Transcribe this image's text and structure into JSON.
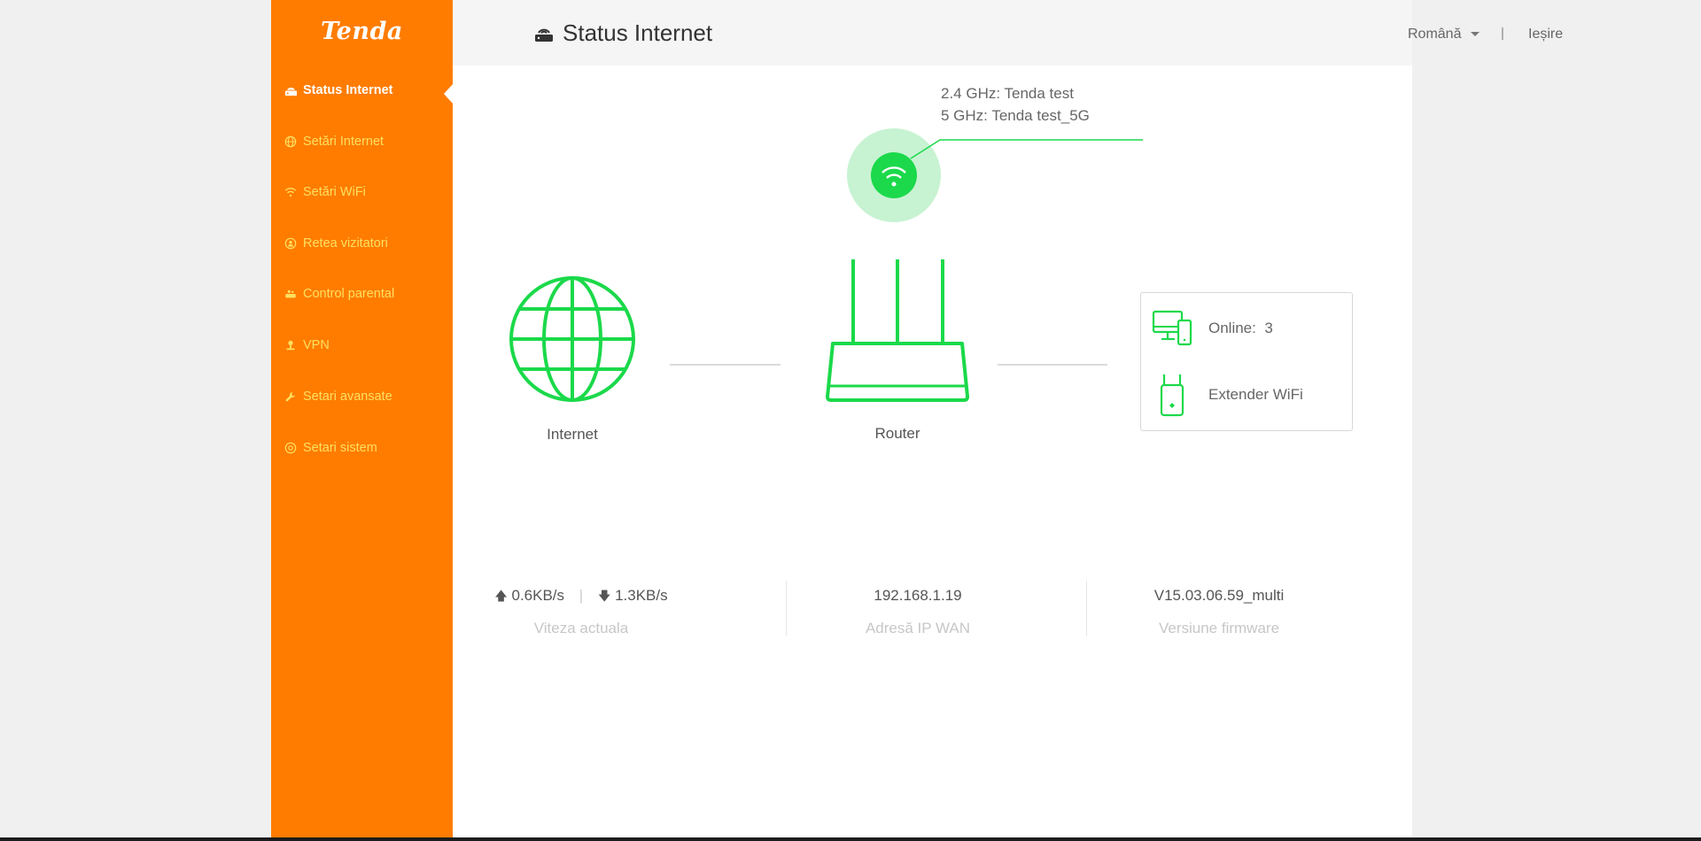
{
  "brand": {
    "logo": "Tenda"
  },
  "sidebar": {
    "items": [
      {
        "label": "Status Internet",
        "icon": "router-status-icon",
        "active": true
      },
      {
        "label": "Setări Internet",
        "icon": "globe-icon"
      },
      {
        "label": "Setări WiFi",
        "icon": "wifi-icon"
      },
      {
        "label": "Retea vizitatori",
        "icon": "guest-network-icon"
      },
      {
        "label": "Control parental",
        "icon": "parental-control-icon"
      },
      {
        "label": "VPN",
        "icon": "vpn-icon"
      },
      {
        "label": "Setari avansate",
        "icon": "wrench-icon"
      },
      {
        "label": "Setari sistem",
        "icon": "gear-icon"
      }
    ]
  },
  "header": {
    "title": "Status Internet",
    "language": "Română",
    "separator": "|",
    "logout": "Ieșire"
  },
  "topology": {
    "wifi": {
      "band_24": "2.4 GHz: Tenda test",
      "band_5": "5 GHz: Tenda test_5G"
    },
    "internet_label": "Internet",
    "router_label": "Router",
    "devices": {
      "online_label": "Online:",
      "online_count": "3",
      "extender_label": "Extender WiFi"
    }
  },
  "stats": {
    "upload": "0.6KB/s",
    "speed_separator": "|",
    "download": "1.3KB/s",
    "speed_label": "Viteza actuala",
    "wan_ip": "192.168.1.19",
    "wan_ip_label": "Adresă IP WAN",
    "firmware": "V15.03.06.59_multi",
    "firmware_label": "Versiune firmware"
  },
  "colors": {
    "sidebar": "#ff7c00",
    "nav_text": "#ffe060",
    "accent_green": "#1bd94a",
    "wifi_halo": "#c7f3d2"
  }
}
